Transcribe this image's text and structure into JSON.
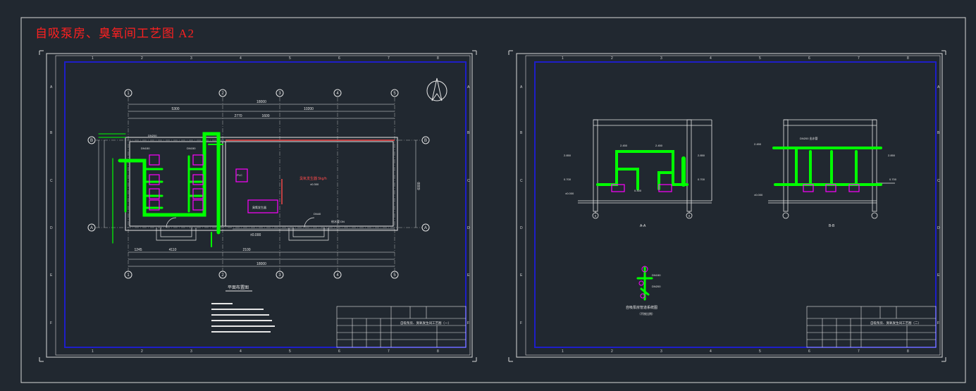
{
  "header": {
    "title": "自吸泵房、臭氧间工艺图   A2"
  },
  "sheet1": {
    "plan_title": "平面布置图",
    "title_block_name": "自吸泵房、臭氧发生间工艺图（一）",
    "dims": {
      "total_top": "18000",
      "left_span": "5300",
      "right_span": "10200",
      "total_bottom": "18000",
      "seg_a": "2770",
      "seg_b": "1600",
      "seg_c": "4110",
      "seg_d": "2100",
      "seg_e": "1245",
      "height": "6000"
    },
    "room_label": "臭氧发生器 5kg/h",
    "level_note": "±0.000"
  },
  "sheet2": {
    "section_a": "A-A",
    "section_b": "B-B",
    "iso_title": "自吸泵房管道系统图",
    "iso_sub": "（不按比例）",
    "title_block_name": "自吸泵房、臭氧发生间工艺图（二）"
  },
  "colors": {
    "background": "#212830",
    "frame": "#d8d8d8",
    "border": "#1e1ec8",
    "pipe": "#00ff00",
    "equipment": "#ff00ff",
    "wall": "#ff4a4a",
    "dim": "#e6e6e6"
  }
}
